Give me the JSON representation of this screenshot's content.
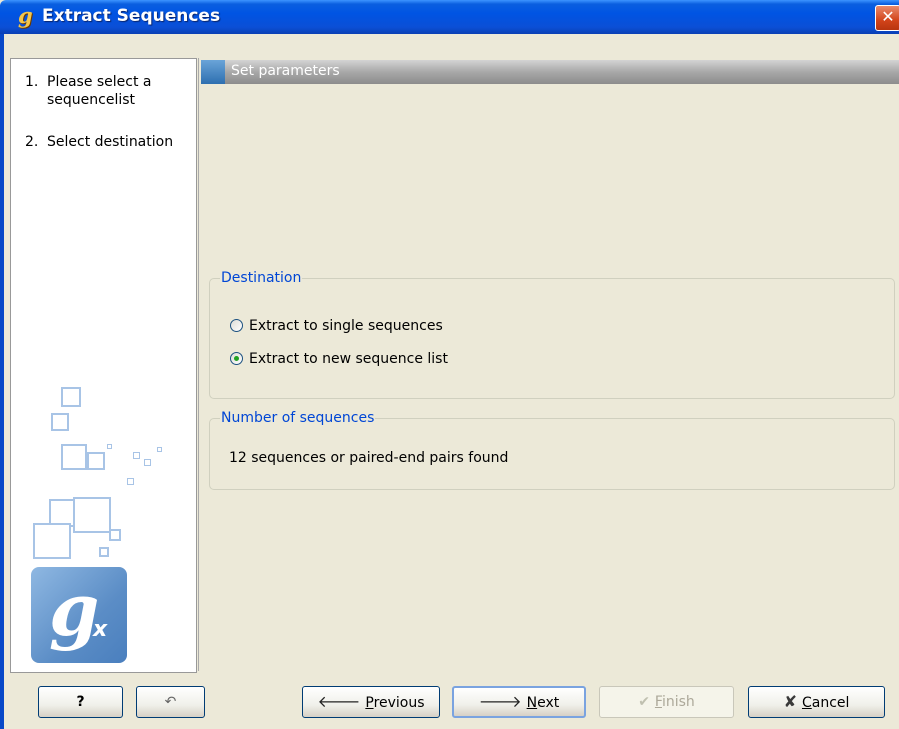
{
  "window": {
    "title": "Extract Sequences",
    "app_icon": "g-icon",
    "close_icon": "close-icon",
    "title_gradient": "#0054e3",
    "close_color": "#d2441a"
  },
  "steps": [
    {
      "number": "1.",
      "label": "Please select a sequencelist"
    },
    {
      "number": "2.",
      "label": "Select destination"
    }
  ],
  "logo": {
    "letter": "g",
    "sub": "x"
  },
  "section": {
    "header": "Set parameters"
  },
  "destination": {
    "legend": "Destination",
    "options": [
      {
        "label": "Extract to single sequences",
        "selected": false
      },
      {
        "label": "Extract to new sequence list",
        "selected": true
      }
    ]
  },
  "number_of_sequences": {
    "legend": "Number of sequences",
    "text": "12 sequences or paired-end pairs found"
  },
  "buttons": {
    "help": {
      "label": "?",
      "icon": "help-icon"
    },
    "undo": {
      "icon": "undo-icon"
    },
    "previous": {
      "label_rest": "revious",
      "mnemonic": "P",
      "icon": "left-arrow-icon"
    },
    "next": {
      "label_rest": "ext",
      "mnemonic": "N",
      "icon": "right-arrow-icon"
    },
    "finish": {
      "label_rest": "inish",
      "mnemonic": "F",
      "icon": "check-icon",
      "enabled": false
    },
    "cancel": {
      "label_rest": "ancel",
      "mnemonic": "C",
      "icon": "x-icon"
    }
  },
  "colors": {
    "legend_blue": "#0046d5",
    "radio_dot": "#21a121",
    "panel_bg": "#ece9d8"
  }
}
